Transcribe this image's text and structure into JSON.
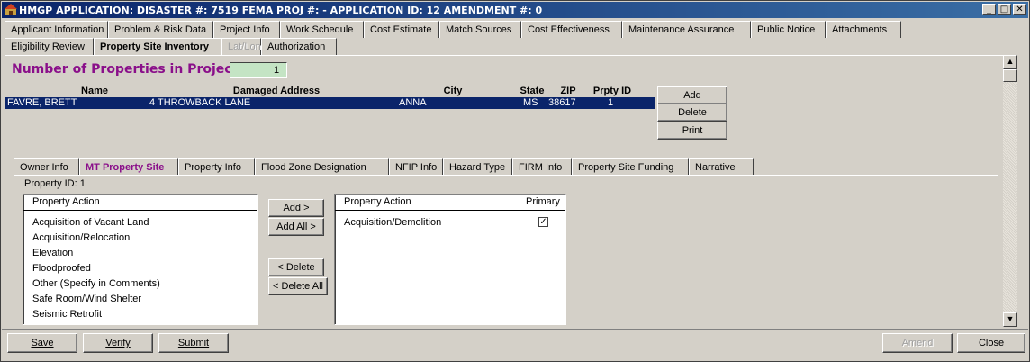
{
  "window": {
    "title": "HMGP APPLICATION:  DISASTER #: 7519   FEMA PROJ #:  -    APPLICATION ID: 12   AMENDMENT #: 0",
    "controls": [
      "_",
      "□",
      "✕"
    ]
  },
  "tabs_row1": [
    "Applicant Information",
    "Problem & Risk Data",
    "Project Info",
    "Work Schedule",
    "Cost Estimate",
    "Match Sources",
    "Cost Effectiveness",
    "Maintenance Assurance",
    "Public Notice",
    "Attachments"
  ],
  "tabs_row2": [
    "Eligibility Review",
    "Property Site Inventory",
    "Lat/Lon",
    "Authorization"
  ],
  "properties": {
    "count_label": "Number of Properties in Project:",
    "count_value": "1",
    "columns": [
      "Name",
      "Damaged Address",
      "City",
      "State",
      "ZIP",
      "Prpty ID"
    ],
    "rows": [
      {
        "name": "FAVRE, BRETT",
        "address": "4 THROWBACK LANE",
        "city": "ANNA",
        "state": "MS",
        "zip": "38617",
        "id": "1"
      }
    ],
    "buttons": {
      "add": "Add",
      "delete": "Delete",
      "print": "Print"
    }
  },
  "subtabs": [
    "Owner Info",
    "MT Property Site",
    "Property Info",
    "Flood Zone Designation",
    "NFIP Info",
    "Hazard Type",
    "FIRM Info",
    "Property Site Funding",
    "Narrative"
  ],
  "site": {
    "property_id_label": "Property ID:  1",
    "available": {
      "header": "Property Action",
      "items": [
        "Acquisition of Vacant Land",
        "Acquisition/Relocation",
        "Elevation",
        "Floodproofed",
        "Other (Specify in Comments)",
        "Safe Room/Wind Shelter",
        "Seismic Retrofit"
      ]
    },
    "selected": {
      "header_action": "Property Action",
      "header_primary": "Primary",
      "items": [
        {
          "action": "Acquisition/Demolition",
          "primary": true
        }
      ]
    },
    "transfer_buttons": {
      "add": "Add >",
      "add_all": "Add All >",
      "delete": "< Delete",
      "delete_all": "< Delete All"
    }
  },
  "footer": {
    "save": "Save",
    "verify": "Verify",
    "submit": "Submit",
    "amend": "Amend",
    "close": "Close"
  },
  "colors": {
    "title_bar": "#0a246a",
    "accent_purple": "#8a0f8a",
    "selection": "#0a246a",
    "count_field": "#c4e4c4",
    "chrome": "#d4d0c8"
  }
}
